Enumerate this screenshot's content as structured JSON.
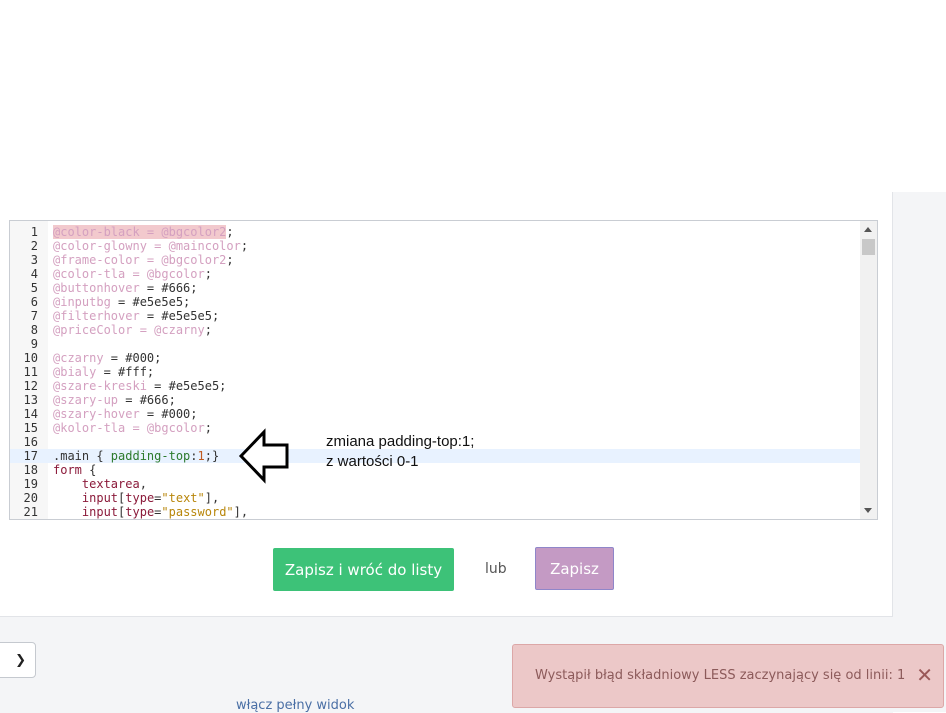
{
  "editor": {
    "lines": [
      {
        "n": "1",
        "tokens": [
          {
            "t": "@color-black = @bgcolor2",
            "c": "var hl"
          },
          {
            "t": ";",
            "c": "sel"
          }
        ]
      },
      {
        "n": "2",
        "tokens": [
          {
            "t": "@color-glowny = @maincolor",
            "c": "var"
          },
          {
            "t": ";",
            "c": "sel"
          }
        ]
      },
      {
        "n": "3",
        "tokens": [
          {
            "t": "@frame-color = @bgcolor2",
            "c": "var"
          },
          {
            "t": ";",
            "c": "sel"
          }
        ]
      },
      {
        "n": "4",
        "tokens": [
          {
            "t": "@color-tla = @bgcolor",
            "c": "var"
          },
          {
            "t": ";",
            "c": "sel"
          }
        ]
      },
      {
        "n": "5",
        "tokens": [
          {
            "t": "@buttonhover",
            "c": "var"
          },
          {
            "t": " = #666;",
            "c": "sel"
          }
        ]
      },
      {
        "n": "6",
        "tokens": [
          {
            "t": "@inputbg",
            "c": "var"
          },
          {
            "t": " = #e5e5e5;",
            "c": "sel"
          }
        ]
      },
      {
        "n": "7",
        "tokens": [
          {
            "t": "@filterhover",
            "c": "var"
          },
          {
            "t": " = #e5e5e5;",
            "c": "sel"
          }
        ]
      },
      {
        "n": "8",
        "tokens": [
          {
            "t": "@priceColor = @czarny",
            "c": "var"
          },
          {
            "t": ";",
            "c": "sel"
          }
        ]
      },
      {
        "n": "9",
        "tokens": []
      },
      {
        "n": "10",
        "tokens": [
          {
            "t": "@czarny",
            "c": "var"
          },
          {
            "t": " = #000;",
            "c": "sel"
          }
        ]
      },
      {
        "n": "11",
        "tokens": [
          {
            "t": "@bialy",
            "c": "var"
          },
          {
            "t": " = #fff;",
            "c": "sel"
          }
        ]
      },
      {
        "n": "12",
        "tokens": [
          {
            "t": "@szare-kreski",
            "c": "var"
          },
          {
            "t": " = #e5e5e5;",
            "c": "sel"
          }
        ]
      },
      {
        "n": "13",
        "tokens": [
          {
            "t": "@szary-up",
            "c": "var"
          },
          {
            "t": " = #666;",
            "c": "sel"
          }
        ]
      },
      {
        "n": "14",
        "tokens": [
          {
            "t": "@szary-hover",
            "c": "var"
          },
          {
            "t": " = #000;",
            "c": "sel"
          }
        ]
      },
      {
        "n": "15",
        "tokens": [
          {
            "t": "@kolor-tla = @bgcolor",
            "c": "var"
          },
          {
            "t": ";",
            "c": "sel"
          }
        ]
      },
      {
        "n": "16",
        "tokens": []
      },
      {
        "n": "17",
        "active": true,
        "tokens": [
          {
            "t": ".main { ",
            "c": "sel"
          },
          {
            "t": "padding-top",
            "c": "prop"
          },
          {
            "t": ":",
            "c": "sel"
          },
          {
            "t": "1",
            "c": "num"
          },
          {
            "t": ";}",
            "c": "sel"
          }
        ]
      },
      {
        "n": "18",
        "tokens": [
          {
            "t": "form",
            "c": "kw"
          },
          {
            "t": " {",
            "c": "sel"
          }
        ]
      },
      {
        "n": "19",
        "tokens": [
          {
            "t": "    textarea",
            "c": "kw"
          },
          {
            "t": ",",
            "c": "sel"
          }
        ]
      },
      {
        "n": "20",
        "tokens": [
          {
            "t": "    input",
            "c": "kw"
          },
          {
            "t": "[",
            "c": "sel"
          },
          {
            "t": "type",
            "c": "kw"
          },
          {
            "t": "=",
            "c": "sel"
          },
          {
            "t": "\"text\"",
            "c": "str"
          },
          {
            "t": "],",
            "c": "sel"
          }
        ]
      },
      {
        "n": "21",
        "tokens": [
          {
            "t": "    input",
            "c": "kw"
          },
          {
            "t": "[",
            "c": "sel"
          },
          {
            "t": "type",
            "c": "kw"
          },
          {
            "t": "=",
            "c": "sel"
          },
          {
            "t": "\"password\"",
            "c": "str"
          },
          {
            "t": "],",
            "c": "sel"
          }
        ]
      }
    ]
  },
  "annotation": {
    "text": "zmiana padding-top:1;  z wartości 0-1"
  },
  "actions": {
    "save_back_label": "Zapisz i wróć do listy",
    "or_label": "lub",
    "save_label": "Zapisz"
  },
  "footer": {
    "full_view_label": "włącz pełny widok"
  },
  "toast": {
    "message": "Wystąpił błąd składniowy LESS zaczynający się od linii: 1",
    "close_label": "✕"
  },
  "colors": {
    "save_back_bg": "#3dc278",
    "save_bg": "#c49ac4",
    "toast_bg": "#ecc8c8"
  }
}
